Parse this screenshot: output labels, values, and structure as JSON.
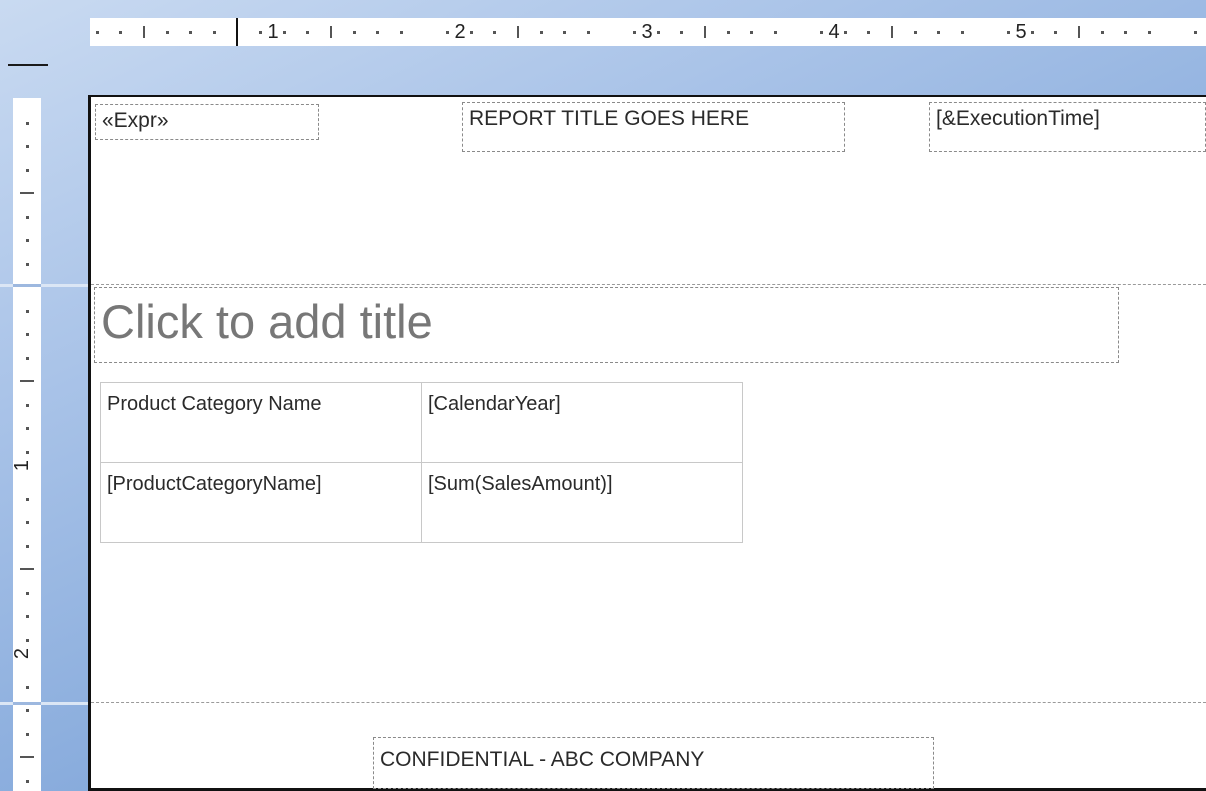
{
  "ruler": {
    "numbers": [
      "1",
      "2",
      "3",
      "4",
      "5"
    ],
    "vertical_numbers": [
      "1",
      "2"
    ]
  },
  "header": {
    "expr": "«Expr»",
    "title": "REPORT TITLE GOES HERE",
    "execution_time": "[&ExecutionTime]"
  },
  "body": {
    "chart_title_placeholder": "Click to add title",
    "table": {
      "header_row": [
        "Product Category Name",
        "[CalendarYear]"
      ],
      "detail_row": [
        "[ProductCategoryName]",
        "[Sum(SalesAmount)]"
      ]
    }
  },
  "footer": {
    "confidential": "CONFIDENTIAL - ABC COMPANY"
  },
  "colors": {
    "background_light": "#c9daf1",
    "background_dark": "#6f98d2",
    "page": "#ffffff",
    "placeholder_text": "#777777"
  }
}
